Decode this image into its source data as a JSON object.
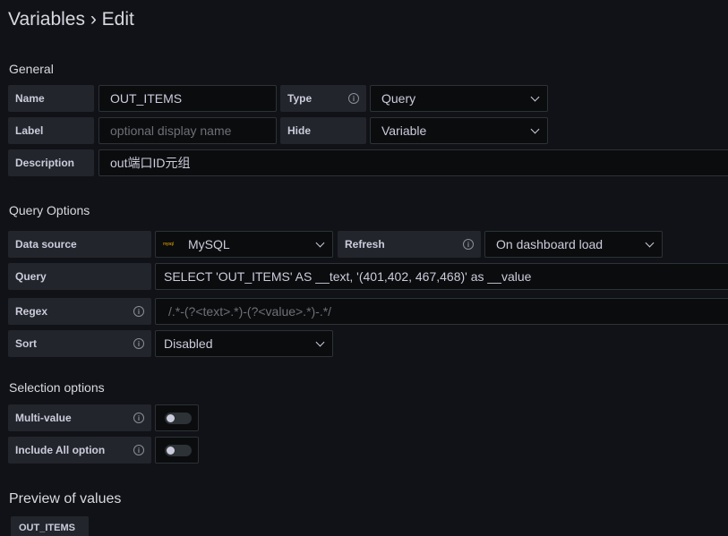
{
  "header": {
    "title": "Variables › Edit"
  },
  "general": {
    "section_title": "General",
    "name_label": "Name",
    "name_value": "OUT_ITEMS",
    "type_label": "Type",
    "type_value": "Query",
    "label_label": "Label",
    "label_placeholder": "optional display name",
    "hide_label": "Hide",
    "hide_value": "Variable",
    "description_label": "Description",
    "description_value": "out端口ID元组"
  },
  "query_options": {
    "section_title": "Query Options",
    "datasource_label": "Data source",
    "datasource_value": "MySQL",
    "datasource_logo": "mysql",
    "refresh_label": "Refresh",
    "refresh_value": "On dashboard load",
    "query_label": "Query",
    "query_value": "SELECT 'OUT_ITEMS' AS __text,  '(401,402, 467,468)' as __value",
    "regex_label": "Regex",
    "regex_placeholder": "/.*-(?<text>.*)-(?<value>.*)-.*/",
    "sort_label": "Sort",
    "sort_value": "Disabled"
  },
  "selection_options": {
    "section_title": "Selection options",
    "multi_value_label": "Multi-value",
    "include_all_label": "Include All option"
  },
  "preview": {
    "section_title": "Preview of values",
    "values": [
      "OUT_ITEMS"
    ]
  },
  "icons": {
    "info": "info-circle-icon",
    "dropdown": "chevron-down-icon"
  }
}
